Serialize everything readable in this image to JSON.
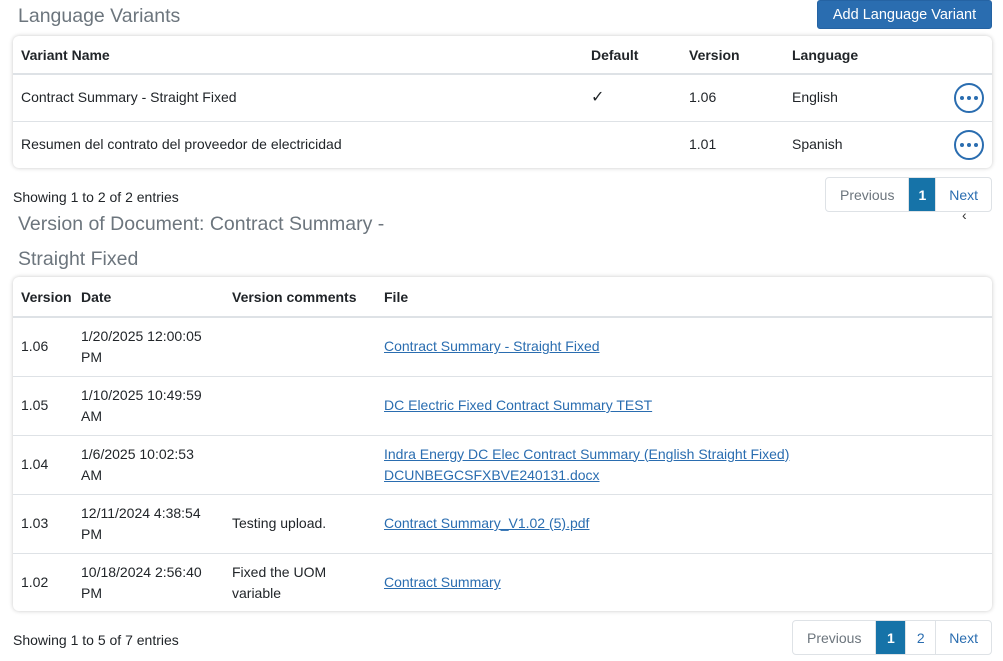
{
  "language_variants": {
    "title": "Language Variants",
    "add_button": "Add Language Variant",
    "headers": {
      "name": "Variant Name",
      "default": "Default",
      "version": "Version",
      "language": "Language"
    },
    "rows": [
      {
        "name": "Contract Summary - Straight Fixed",
        "default": "✓",
        "version": "1.06",
        "language": "English"
      },
      {
        "name": "Resumen del contrato del proveedor de electricidad",
        "default": "",
        "version": "1.01",
        "language": "Spanish"
      }
    ],
    "entries": "Showing 1 to 2 of 2 entries",
    "pager": {
      "prev": "Previous",
      "pages": [
        "1"
      ],
      "next": "Next"
    }
  },
  "versions": {
    "title": "Version of Document: Contract Summary - Straight Fixed",
    "chevron": "‹",
    "headers": {
      "version": "Version",
      "date": "Date",
      "comments": "Version comments",
      "file": "File"
    },
    "rows": [
      {
        "version": "1.06",
        "date": "1/20/2025 12:00:05 PM",
        "comments": "",
        "file": "Contract Summary - Straight Fixed"
      },
      {
        "version": "1.05",
        "date": "1/10/2025 10:49:59 AM",
        "comments": "",
        "file": "DC Electric Fixed Contract Summary TEST"
      },
      {
        "version": "1.04",
        "date": "1/6/2025 10:02:53 AM",
        "comments": "",
        "file": "Indra Energy DC Elec Contract Summary (English Straight Fixed) DCUNBEGCSFXBVE240131.docx"
      },
      {
        "version": "1.03",
        "date": "12/11/2024 4:38:54 PM",
        "comments": "Testing upload.",
        "file": "Contract Summary_V1.02 (5).pdf"
      },
      {
        "version": "1.02",
        "date": "10/18/2024 2:56:40 PM",
        "comments": "Fixed the UOM variable",
        "file": "Contract Summary"
      }
    ],
    "entries": "Showing 1 to 5 of 7 entries",
    "pager": {
      "prev": "Previous",
      "pages": [
        "1",
        "2"
      ],
      "next": "Next"
    }
  },
  "colors": {
    "accent": "#2a6db0",
    "active_page": "#1673a8"
  }
}
